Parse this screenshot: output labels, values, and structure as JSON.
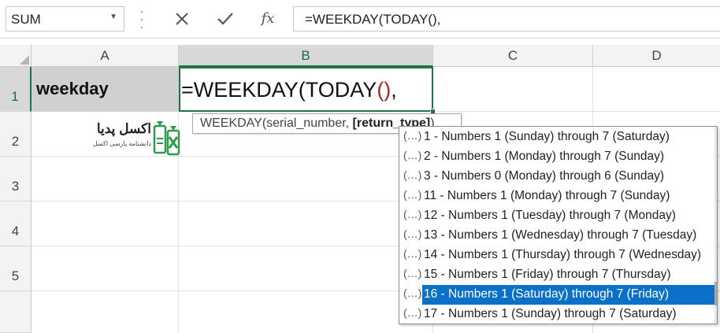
{
  "formula_bar": {
    "name_box": "SUM",
    "fx": "fx",
    "formula": "=WEEKDAY(TODAY(),"
  },
  "columns": [
    "A",
    "B",
    "C",
    "D"
  ],
  "rows": [
    "1",
    "2",
    "3",
    "4",
    "5"
  ],
  "cells": {
    "A1": "weekday",
    "B1_prefix": "=WEEKDAY(TODAY",
    "B1_parens": "()",
    "B1_suffix": ","
  },
  "logo": {
    "name": "اکسل پدیا",
    "subtitle": "دانشنامه پارسی اکسل"
  },
  "tooltip": {
    "function": "WEEKDAY",
    "open": "(",
    "arg1": "serial_number, ",
    "arg2": "[return_type]",
    "close": ")"
  },
  "autocomplete": {
    "icon": "(…)",
    "selected_index": 8,
    "items": [
      "1 - Numbers 1 (Sunday) through 7 (Saturday)",
      "2 - Numbers 1 (Monday) through 7 (Sunday)",
      "3 - Numbers 0 (Monday) through 6 (Sunday)",
      "11 - Numbers 1 (Monday) through 7 (Sunday)",
      "12 - Numbers 1 (Tuesday) through 7 (Monday)",
      "13 - Numbers 1 (Wednesday) through 7 (Tuesday)",
      "14 - Numbers 1 (Thursday) through 7 (Wednesday)",
      "15 - Numbers 1 (Friday) through 7 (Thursday)",
      "16 - Numbers 1 (Saturday) through 7 (Friday)",
      "17 - Numbers 1 (Sunday) through 7 (Saturday)"
    ]
  },
  "colors": {
    "excel_green": "#217346",
    "selection_blue": "#0a70c8",
    "paren_red": "#a4262c",
    "logo_green": "#2e9a4a"
  }
}
